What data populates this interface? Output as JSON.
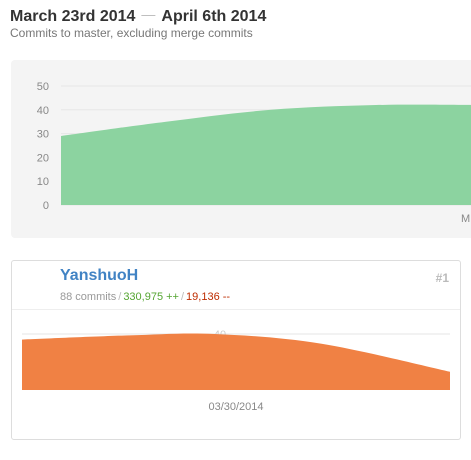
{
  "header": {
    "start_date": "March 23rd 2014",
    "separator": "—",
    "end_date": "April 6th 2014",
    "subtitle": "Commits to master, excluding merge commits"
  },
  "colors": {
    "overview_fill": "#8cd3a0",
    "contributor_fill": "#f08144",
    "username": "#4183c4",
    "additions": "#55a532",
    "deletions": "#bd2c00"
  },
  "chart_data": [
    {
      "type": "area",
      "title": "",
      "xlabel": "",
      "ylabel": "",
      "ylim": [
        0,
        50
      ],
      "yticks": [
        "50",
        "40",
        "30",
        "20",
        "10",
        "0"
      ],
      "x_tick_labels": [
        "M"
      ],
      "series": [
        {
          "x": [
            0,
            0.25,
            0.5,
            0.75,
            1.0
          ],
          "values": [
            29,
            35,
            40,
            42,
            42
          ]
        }
      ],
      "grid": true
    },
    {
      "type": "area",
      "title": "",
      "xlabel": "",
      "ylabel": "",
      "ylim": [
        0,
        50
      ],
      "yticks": [
        "40"
      ],
      "x_tick_labels": [
        "03/30/2014"
      ],
      "series": [
        {
          "x": [
            0,
            0.25,
            0.45,
            0.7,
            1.0
          ],
          "values": [
            36,
            39,
            40,
            33,
            13
          ]
        }
      ],
      "grid": true
    }
  ],
  "contributor": {
    "username": "YanshuoH",
    "rank": "#1",
    "commits": "88 commits",
    "stat_sep": "/",
    "additions": "330,975 ++",
    "deletions": "19,136 --",
    "avatar_icon": "skull-avatar-icon"
  }
}
